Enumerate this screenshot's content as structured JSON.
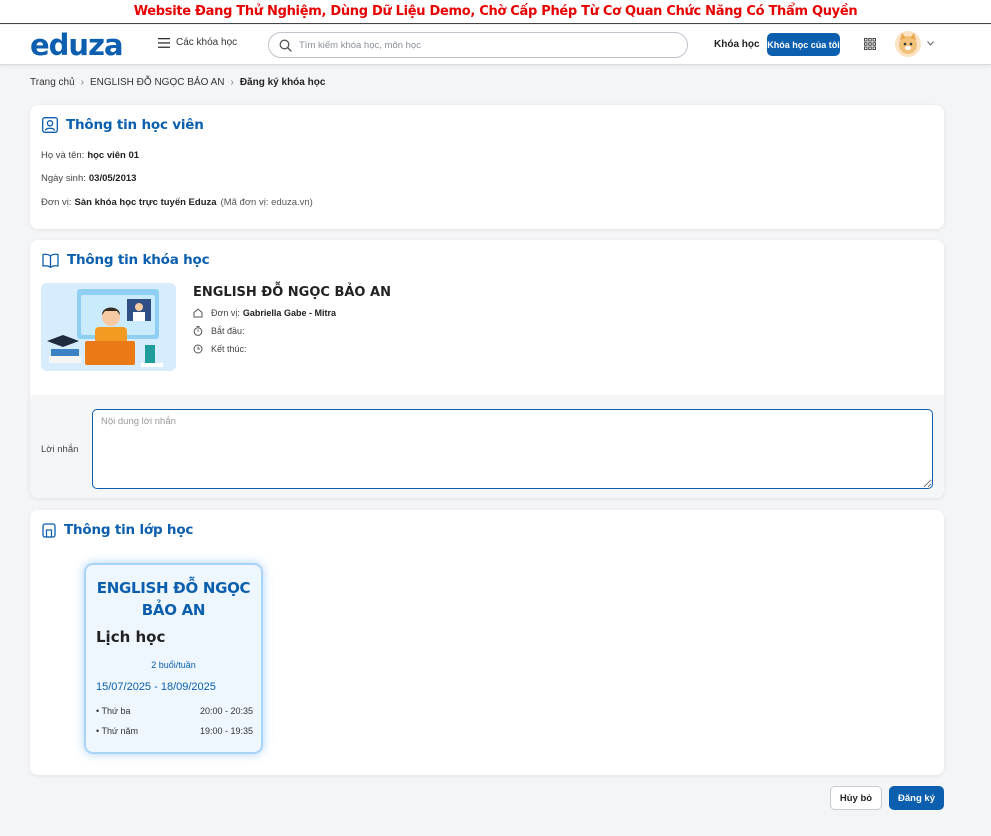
{
  "banner": {
    "text": "Website Đang Thử Nghiệm, Dùng Dữ Liệu Demo, Chờ Cấp Phép Từ Cơ Quan Chức Năng Có Thẩm Quyền",
    "color": "#e60000"
  },
  "header": {
    "logo": "eduza",
    "courses_menu": "Các khóa học",
    "search_placeholder": "Tìm kiếm khóa học, môn học",
    "nav_courses": "Khóa học",
    "my_courses_button": "Khóa học của tôi",
    "icons": [
      "menu-icon",
      "search-icon",
      "apps-grid-icon",
      "avatar",
      "chevron-down-icon"
    ]
  },
  "breadcrumb": [
    "Trang chủ",
    "ENGLISH ĐỖ NGỌC BẢO AN",
    "Đăng ký khóa học"
  ],
  "student": {
    "title": "Thông tin học viên",
    "name_label": "Họ và tên:",
    "name": "học viên 01",
    "dob_label": "Ngày sinh:",
    "dob": "03/05/2013",
    "unit_label": "Đơn vị:",
    "unit": "Sàn khóa học trực tuyến Eduza",
    "unit_code": "(Mã đơn vị: eduza.vn)"
  },
  "course": {
    "title": "Thông tin khóa học",
    "name": "ENGLISH ĐỖ NGỌC BẢO AN",
    "unit_label": "Đơn vị:",
    "unit": "Gabriella Gabe - Mitra",
    "start_label": "Bắt đầu:",
    "end_label": "Kết thúc:",
    "message_label": "Lời nhắn",
    "message_placeholder": "Nội dung lời nhắn"
  },
  "class": {
    "title": "Thông tin lớp học",
    "name": "ENGLISH ĐỖ NGỌC BẢO AN",
    "schedule_title": "Lịch học",
    "frequency": "2 buổi/tuần",
    "date_range": "15/07/2025 - 18/09/2025",
    "sessions": [
      {
        "day": "• Thứ ba",
        "time": "20:00 - 20:35"
      },
      {
        "day": "• Thứ năm",
        "time": "19:00 - 19:35"
      }
    ]
  },
  "actions": {
    "cancel": "Hủy bỏ",
    "register": "Đăng ký"
  },
  "colors": {
    "primary": "#0b5fae",
    "page_bg": "#f4f5f7"
  }
}
